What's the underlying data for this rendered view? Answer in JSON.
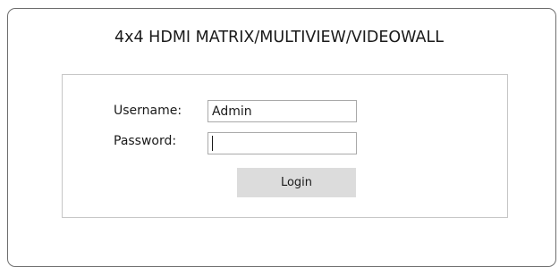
{
  "header": {
    "title": "4x4 HDMI MATRIX/MULTIVIEW/VIDEOWALL"
  },
  "login": {
    "username_label": "Username:",
    "username_value": "Admin",
    "password_label": "Password:",
    "password_value": "",
    "button_label": "Login"
  },
  "colors": {
    "button_background": "#dcdcdc",
    "border": "#6e6e6e",
    "text": "#1a1a1a"
  }
}
